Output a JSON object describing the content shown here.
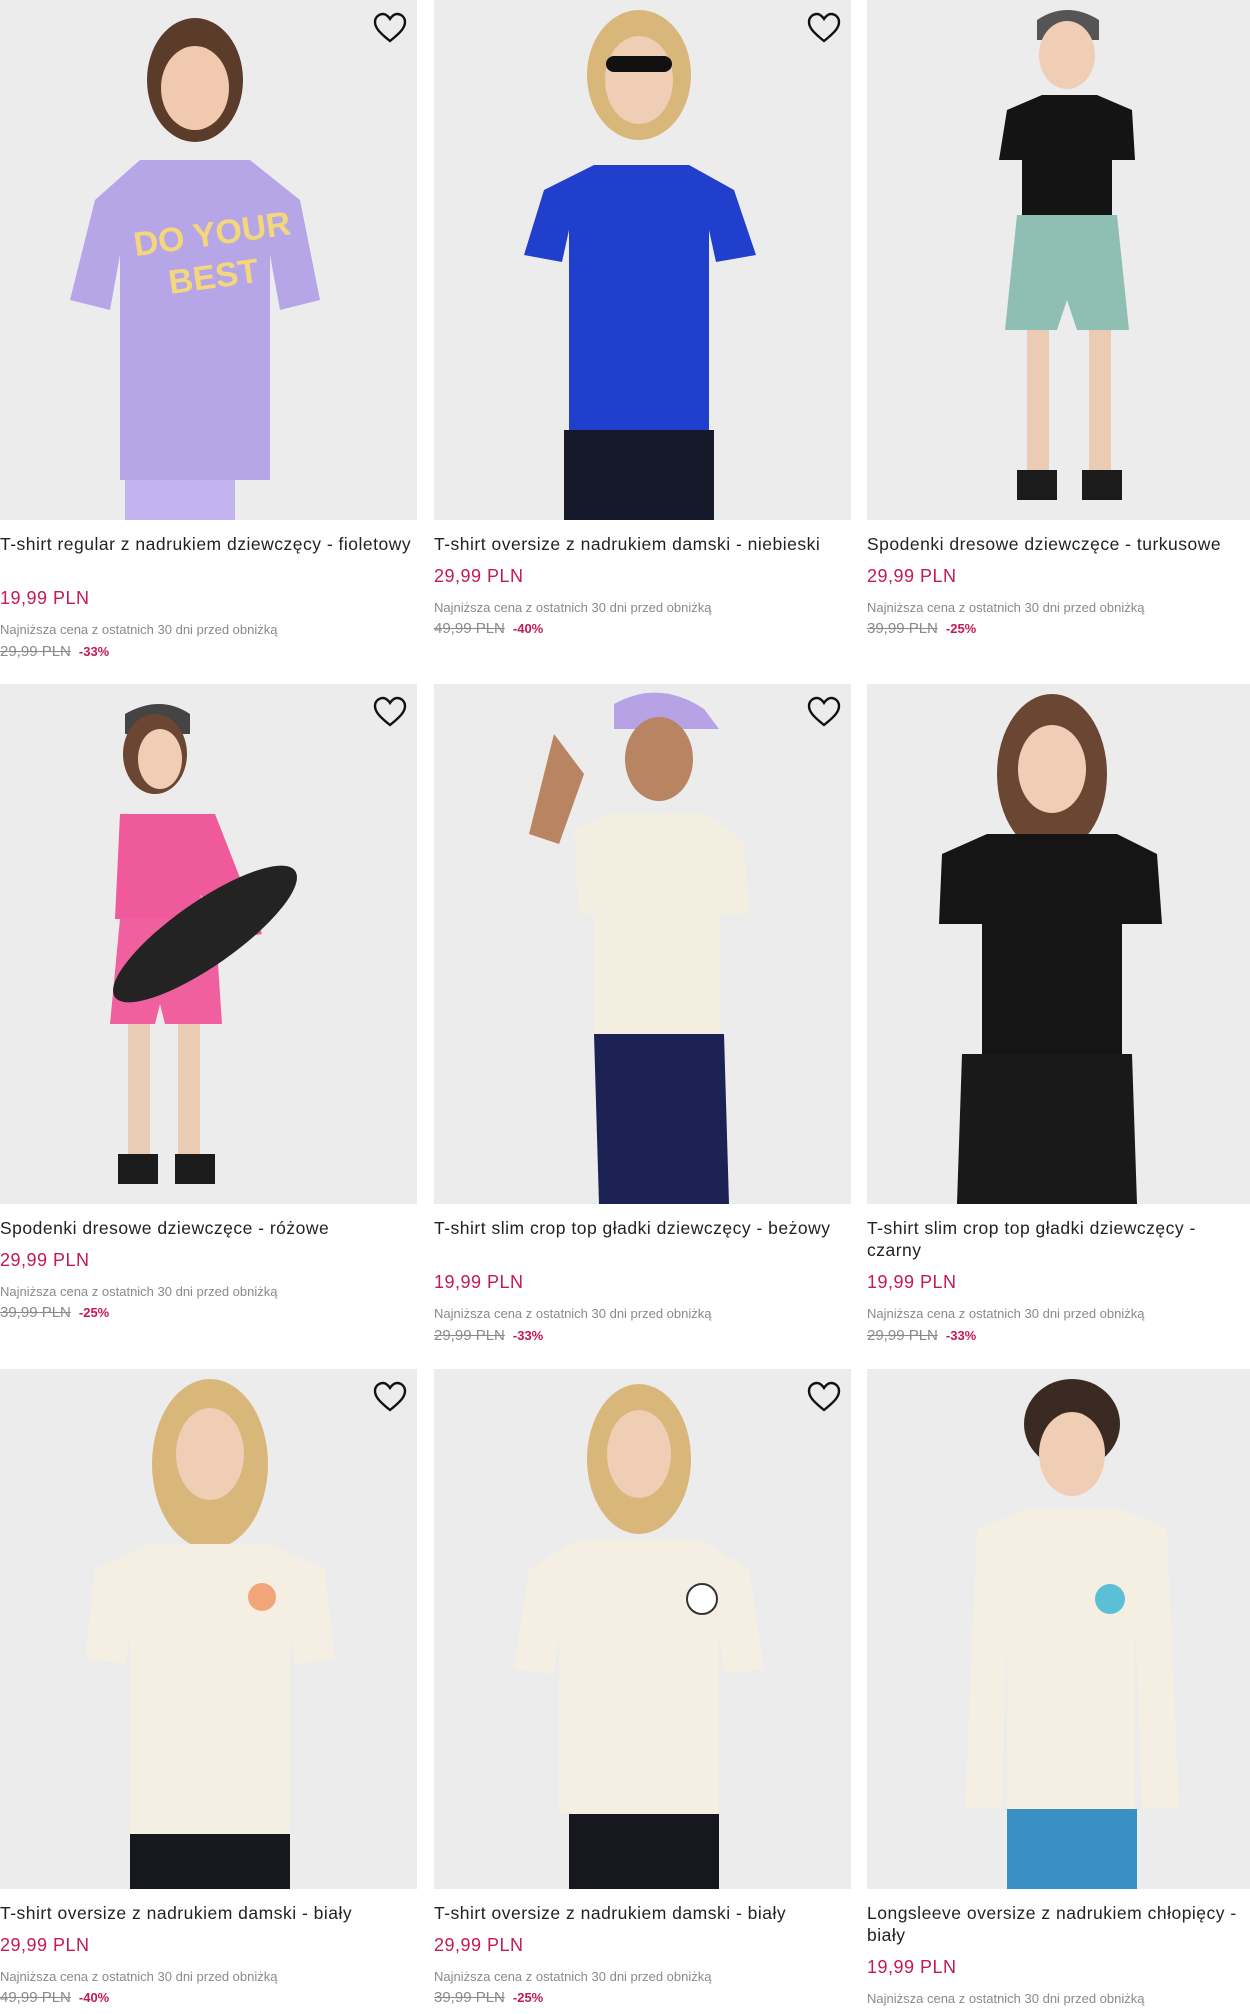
{
  "products": [
    {
      "title": "T-shirt regular z nadrukiem dziewczęcy - fioletowy",
      "price": "19,99 PLN",
      "lowest_label": "Najniższa cena z ostatnich 30 dni przed obniżką",
      "old_price": "29,99 PLN",
      "discount": "-33%",
      "favorite_icon": "heart-outline-icon",
      "photo": "girl-lilac-tshirt-print"
    },
    {
      "title": "T-shirt oversize z nadrukiem damski - niebieski",
      "price": "29,99 PLN",
      "lowest_label": "Najniższa cena z ostatnich 30 dni przed obniżką",
      "old_price": "49,99 PLN",
      "discount": "-40%",
      "favorite_icon": "heart-outline-icon",
      "photo": "woman-blue-tshirt"
    },
    {
      "title": "Spodenki dresowe dziewczęce - turkusowe",
      "price": "29,99 PLN",
      "lowest_label": "Najniższa cena z ostatnich 30 dni przed obniżką",
      "old_price": "39,99 PLN",
      "discount": "-25%",
      "favorite_icon": "heart-outline-icon",
      "photo": "girl-turquoise-shorts"
    },
    {
      "title": "Spodenki dresowe dziewczęce - różowe",
      "price": "29,99 PLN",
      "lowest_label": "Najniższa cena z ostatnich 30 dni przed obniżką",
      "old_price": "39,99 PLN",
      "discount": "-25%",
      "favorite_icon": "heart-outline-icon",
      "photo": "girl-pink-skateboard"
    },
    {
      "title": "T-shirt slim crop top gładki dziewczęcy - beżowy",
      "price": "19,99 PLN",
      "lowest_label": "Najniższa cena z ostatnich 30 dni przed obniżką",
      "old_price": "29,99 PLN",
      "discount": "-33%",
      "favorite_icon": "heart-outline-icon",
      "photo": "girl-beige-crop-top"
    },
    {
      "title": "T-shirt slim crop top gładki dziewczęcy - czarny",
      "price": "19,99 PLN",
      "lowest_label": "Najniższa cena z ostatnich 30 dni przed obniżką",
      "old_price": "29,99 PLN",
      "discount": "-33%",
      "favorite_icon": "heart-outline-icon",
      "photo": "girl-black-crop-top"
    },
    {
      "title": "T-shirt oversize z nadrukiem damski - biały",
      "price": "29,99 PLN",
      "lowest_label": "Najniższa cena z ostatnich 30 dni przed obniżką",
      "old_price": "49,99 PLN",
      "discount": "-40%",
      "favorite_icon": "heart-outline-icon",
      "photo": "woman-white-tshirt-1"
    },
    {
      "title": "T-shirt oversize z nadrukiem damski - biały",
      "price": "29,99 PLN",
      "lowest_label": "Najniższa cena z ostatnich 30 dni przed obniżką",
      "old_price": "39,99 PLN",
      "discount": "-25%",
      "favorite_icon": "heart-outline-icon",
      "photo": "woman-white-tshirt-2"
    },
    {
      "title": "Longsleeve oversize z nadrukiem chłopięcy - biały",
      "price": "19,99 PLN",
      "lowest_label": "Najniższa cena z ostatnich 30 dni przed obniżką",
      "old_price": "",
      "discount": "",
      "favorite_icon": "heart-outline-icon",
      "photo": "boy-white-longsleeve"
    }
  ],
  "colors": {
    "price": "#c6194f",
    "muted": "#8a8a8a",
    "photo_bg": "#e9e9e9",
    "text": "#222222"
  }
}
